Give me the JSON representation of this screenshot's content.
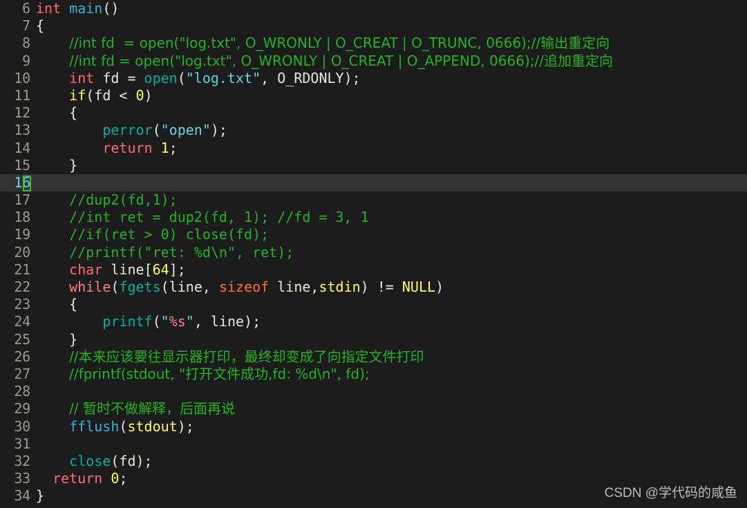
{
  "editor": {
    "theme_background": "#1c1c1c",
    "active_line_background": "#333333",
    "gutter_color": "#9a9a92",
    "active_gutter_color": "#7cc5f0",
    "cursor_color": "#22cc22",
    "cursor_line": 16,
    "first_visible_line": 6,
    "last_visible_line": 34
  },
  "watermark": {
    "text": "CSDN @学代码的咸鱼"
  },
  "lines": [
    {
      "number": "6",
      "indent": "",
      "tokens": [
        {
          "t": "int",
          "c": "kw"
        },
        {
          "t": " ",
          "c": "plain"
        },
        {
          "t": "main",
          "c": "fn2"
        },
        {
          "t": "()",
          "c": "punct"
        }
      ]
    },
    {
      "number": "7",
      "indent": "",
      "tokens": [
        {
          "t": "{",
          "c": "punct"
        }
      ]
    },
    {
      "number": "8",
      "indent": "    ",
      "tokens": [
        {
          "t": "//int fd  = open(\"log.txt\", O_WRONLY | O_CREAT | O_TRUNC, 0666);//输出重定向",
          "c": "cmt"
        }
      ]
    },
    {
      "number": "9",
      "indent": "    ",
      "tokens": [
        {
          "t": "//int fd = open(\"log.txt\", O_WRONLY | O_CREAT | O_APPEND, 0666);//追加重定向",
          "c": "cmt"
        }
      ]
    },
    {
      "number": "10",
      "indent": "    ",
      "tokens": [
        {
          "t": "int",
          "c": "kw"
        },
        {
          "t": " fd = ",
          "c": "plain"
        },
        {
          "t": "open",
          "c": "fn"
        },
        {
          "t": "(",
          "c": "punct"
        },
        {
          "t": "\"log.txt\"",
          "c": "str"
        },
        {
          "t": ", ",
          "c": "plain"
        },
        {
          "t": "O_RDONLY",
          "c": "mac"
        },
        {
          "t": ");",
          "c": "punct"
        }
      ]
    },
    {
      "number": "11",
      "indent": "    ",
      "tokens": [
        {
          "t": "if",
          "c": "kw2"
        },
        {
          "t": "(fd < ",
          "c": "plain"
        },
        {
          "t": "0",
          "c": "num"
        },
        {
          "t": ")",
          "c": "punct"
        }
      ]
    },
    {
      "number": "12",
      "indent": "    ",
      "tokens": [
        {
          "t": "{",
          "c": "punct"
        }
      ]
    },
    {
      "number": "13",
      "indent": "        ",
      "tokens": [
        {
          "t": "perror",
          "c": "fn"
        },
        {
          "t": "(",
          "c": "punct"
        },
        {
          "t": "\"open\"",
          "c": "str"
        },
        {
          "t": ");",
          "c": "punct"
        }
      ]
    },
    {
      "number": "14",
      "indent": "        ",
      "tokens": [
        {
          "t": "return",
          "c": "kw"
        },
        {
          "t": " ",
          "c": "plain"
        },
        {
          "t": "1",
          "c": "num"
        },
        {
          "t": ";",
          "c": "punct"
        }
      ]
    },
    {
      "number": "15",
      "indent": "    ",
      "tokens": [
        {
          "t": "}",
          "c": "punct"
        }
      ]
    },
    {
      "number": "16",
      "indent": "",
      "tokens": [],
      "active": true
    },
    {
      "number": "17",
      "indent": "    ",
      "tokens": [
        {
          "t": "//dup2(fd,1);",
          "c": "cmt"
        }
      ]
    },
    {
      "number": "18",
      "indent": "    ",
      "tokens": [
        {
          "t": "//int ret = dup2(fd, 1); //fd = 3, 1",
          "c": "cmt"
        }
      ]
    },
    {
      "number": "19",
      "indent": "    ",
      "tokens": [
        {
          "t": "//if(ret > 0) close(fd);",
          "c": "cmt"
        }
      ]
    },
    {
      "number": "20",
      "indent": "    ",
      "tokens": [
        {
          "t": "//printf(\"ret: %d\\n\", ret);",
          "c": "cmt"
        }
      ]
    },
    {
      "number": "21",
      "indent": "    ",
      "tokens": [
        {
          "t": "char",
          "c": "kw"
        },
        {
          "t": " line[",
          "c": "plain"
        },
        {
          "t": "64",
          "c": "num"
        },
        {
          "t": "];",
          "c": "punct"
        }
      ]
    },
    {
      "number": "22",
      "indent": "    ",
      "tokens": [
        {
          "t": "while",
          "c": "kw3"
        },
        {
          "t": "(",
          "c": "punct"
        },
        {
          "t": "fgets",
          "c": "fn"
        },
        {
          "t": "(line, ",
          "c": "plain"
        },
        {
          "t": "sizeof",
          "c": "sizeof"
        },
        {
          "t": " line,",
          "c": "plain"
        },
        {
          "t": "stdin",
          "c": "ident-y"
        },
        {
          "t": ") != ",
          "c": "plain"
        },
        {
          "t": "NULL",
          "c": "ident-y"
        },
        {
          "t": ")",
          "c": "punct"
        }
      ]
    },
    {
      "number": "23",
      "indent": "    ",
      "tokens": [
        {
          "t": "{",
          "c": "punct"
        }
      ]
    },
    {
      "number": "24",
      "indent": "        ",
      "tokens": [
        {
          "t": "printf",
          "c": "fn"
        },
        {
          "t": "(",
          "c": "punct"
        },
        {
          "t": "\"",
          "c": "str"
        },
        {
          "t": "%s",
          "c": "pct"
        },
        {
          "t": "\"",
          "c": "str"
        },
        {
          "t": ", line);",
          "c": "plain"
        }
      ]
    },
    {
      "number": "25",
      "indent": "    ",
      "tokens": [
        {
          "t": "}",
          "c": "punct"
        }
      ]
    },
    {
      "number": "26",
      "indent": "    ",
      "tokens": [
        {
          "t": "//本来应该要往显示器打印，最终却变成了向指定文件打印",
          "c": "cmt"
        }
      ]
    },
    {
      "number": "27",
      "indent": "    ",
      "tokens": [
        {
          "t": "//fprintf(stdout, \"打开文件成功,fd: %d\\n\", fd);",
          "c": "cmt"
        }
      ]
    },
    {
      "number": "28",
      "indent": "",
      "tokens": []
    },
    {
      "number": "29",
      "indent": "    ",
      "tokens": [
        {
          "t": "// 暂时不做解释，后面再说",
          "c": "cmt"
        }
      ]
    },
    {
      "number": "30",
      "indent": "    ",
      "tokens": [
        {
          "t": "fflush",
          "c": "fn2"
        },
        {
          "t": "(",
          "c": "punct"
        },
        {
          "t": "stdout",
          "c": "ident-y"
        },
        {
          "t": ");",
          "c": "punct"
        }
      ]
    },
    {
      "number": "31",
      "indent": "",
      "tokens": []
    },
    {
      "number": "32",
      "indent": "    ",
      "tokens": [
        {
          "t": "close",
          "c": "fn"
        },
        {
          "t": "(fd);",
          "c": "plain"
        }
      ]
    },
    {
      "number": "33",
      "indent": "  ",
      "tokens": [
        {
          "t": "return",
          "c": "kw"
        },
        {
          "t": " ",
          "c": "plain"
        },
        {
          "t": "0",
          "c": "num"
        },
        {
          "t": ";",
          "c": "punct"
        }
      ]
    },
    {
      "number": "34",
      "indent": "",
      "tokens": [
        {
          "t": "}",
          "c": "punct"
        }
      ]
    }
  ]
}
